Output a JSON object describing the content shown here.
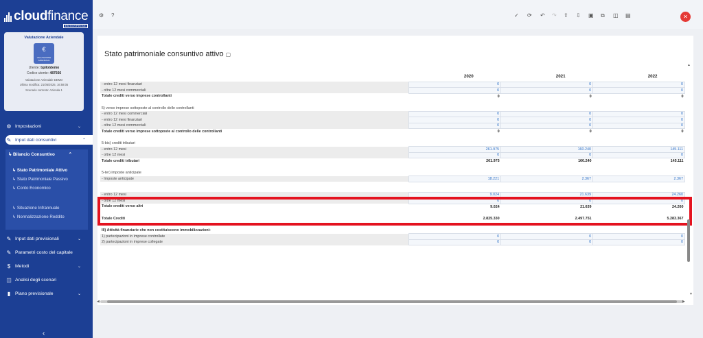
{
  "brand": {
    "name_bold": "cloud",
    "name_thin": "finance",
    "sub": "ENTERPRISE"
  },
  "company_card": {
    "title": "Valutazione Aziendale",
    "icon_text": "€",
    "icon_sub": "VALUTAZIONE AZIENDALE",
    "user_label": "Utente:",
    "user_value": "bpilotdemo",
    "code_label": "Codice utente:",
    "code_value": "487566",
    "company": "Valutazione Aziendale DEMO",
    "last_modified": "Ultima modifica: 21/05/2025, 16:58:05",
    "scenario": "Scenario corrente: Azienda 1"
  },
  "nav": {
    "impostazioni": "Impostazioni",
    "input_consuntivi": "Input dati consuntivi",
    "bilancio": "Bilancio Consuntivo",
    "spa": "Stato Patrimoniale Attivo",
    "spp": "Stato Patrimoniale Passivo",
    "ce": "Conto Economico",
    "infrannuale": "Situazione Infrannuale",
    "normalizzazione": "Normalizzazione Reddito",
    "previsionali": "Input dati previsionali",
    "parametri": "Parametri costo del capitale",
    "metodi": "Metodi",
    "analisi": "Analisi degli scenari",
    "piano": "Piano previsionale"
  },
  "panel": {
    "title": "Stato patrimoniale consuntivo attivo"
  },
  "years": [
    "2020",
    "2021",
    "2022"
  ],
  "rows": [
    {
      "label": "- entro 12 mesi finanziari",
      "vals": [
        "0",
        "0",
        "0"
      ],
      "type": "input",
      "shade": true
    },
    {
      "label": "- oltre 12 mesi commerciali",
      "vals": [
        "0",
        "0",
        "0"
      ],
      "type": "input",
      "shade": true
    },
    {
      "label": "Totale crediti verso imprese controllanti",
      "vals": [
        "0",
        "0",
        "0"
      ],
      "type": "total"
    },
    {
      "label": "",
      "vals": [
        "",
        "",
        ""
      ],
      "type": "empty"
    },
    {
      "label": "5) verso imprese sottoposte al controllo delle controllanti",
      "vals": [
        "",
        "",
        ""
      ],
      "type": "section"
    },
    {
      "label": "- entro 12 mesi commerciali",
      "vals": [
        "0",
        "0",
        "0"
      ],
      "type": "input",
      "shade": true
    },
    {
      "label": "- entro 12 mesi finanziari",
      "vals": [
        "0",
        "0",
        "0"
      ],
      "type": "input",
      "shade": true
    },
    {
      "label": "- oltre 12 mesi commerciali",
      "vals": [
        "0",
        "0",
        "0"
      ],
      "type": "input",
      "shade": true
    },
    {
      "label": "Totale crediti verso imprese sottoposte al controllo delle controllanti",
      "vals": [
        "0",
        "0",
        "0"
      ],
      "type": "total"
    },
    {
      "label": "",
      "vals": [
        "",
        "",
        ""
      ],
      "type": "empty"
    },
    {
      "label": "5-bis) crediti tributari",
      "vals": [
        "",
        "",
        ""
      ],
      "type": "section"
    },
    {
      "label": "- entro 12 mesi",
      "vals": [
        "261.975",
        "160.240",
        "145.111"
      ],
      "type": "input",
      "shade": true
    },
    {
      "label": "- oltre 12 mesi",
      "vals": [
        "0",
        "0",
        "0"
      ],
      "type": "input",
      "shade": true
    },
    {
      "label": "Totale crediti tributari",
      "vals": [
        "261.975",
        "160.240",
        "145.111"
      ],
      "type": "total"
    },
    {
      "label": "",
      "vals": [
        "",
        "",
        ""
      ],
      "type": "empty"
    },
    {
      "label": "5-ter) imposte anticipate",
      "vals": [
        "",
        "",
        ""
      ],
      "type": "section"
    },
    {
      "label": "- Imposte anticipate",
      "vals": [
        "18.221",
        "2.367",
        "2.367"
      ],
      "type": "input",
      "shade": true
    },
    {
      "label": "",
      "vals": [
        "",
        "",
        ""
      ],
      "type": "empty"
    },
    {
      "label": "",
      "vals": [
        "",
        "",
        ""
      ],
      "type": "gap"
    },
    {
      "label": "- entro 12 mesi",
      "vals": [
        "9.024",
        "21.639",
        "24.260"
      ],
      "type": "input",
      "shade": true
    },
    {
      "label": "- oltre 12 mesi",
      "vals": [
        "0",
        "0",
        "0"
      ],
      "type": "input",
      "shade": true
    },
    {
      "label": "Totale crediti verso altri",
      "vals": [
        "9.024",
        "21.639",
        "24.260"
      ],
      "type": "total"
    },
    {
      "label": "",
      "vals": [
        "",
        "",
        ""
      ],
      "type": "empty"
    },
    {
      "label": "Totale Crediti",
      "vals": [
        "2.825.330",
        "2.497.751",
        "5.283.367"
      ],
      "type": "total"
    },
    {
      "label": "",
      "vals": [
        "",
        "",
        ""
      ],
      "type": "empty"
    },
    {
      "label": "III) Attività finanziarie che non costituiscono immobilizzazioni:",
      "vals": [
        "",
        "",
        ""
      ],
      "type": "total"
    },
    {
      "label": "1) partecipazioni in imprese controllate",
      "vals": [
        "0",
        "0",
        "0"
      ],
      "type": "input",
      "shade": true
    },
    {
      "label": "2) partecipazioni in imprese collegate",
      "vals": [
        "0",
        "0",
        "0"
      ],
      "type": "input",
      "shade": true
    }
  ],
  "colors": {
    "sidebar": "#1c3f94",
    "highlight": "#e4121f",
    "input_text": "#2f72c8"
  }
}
